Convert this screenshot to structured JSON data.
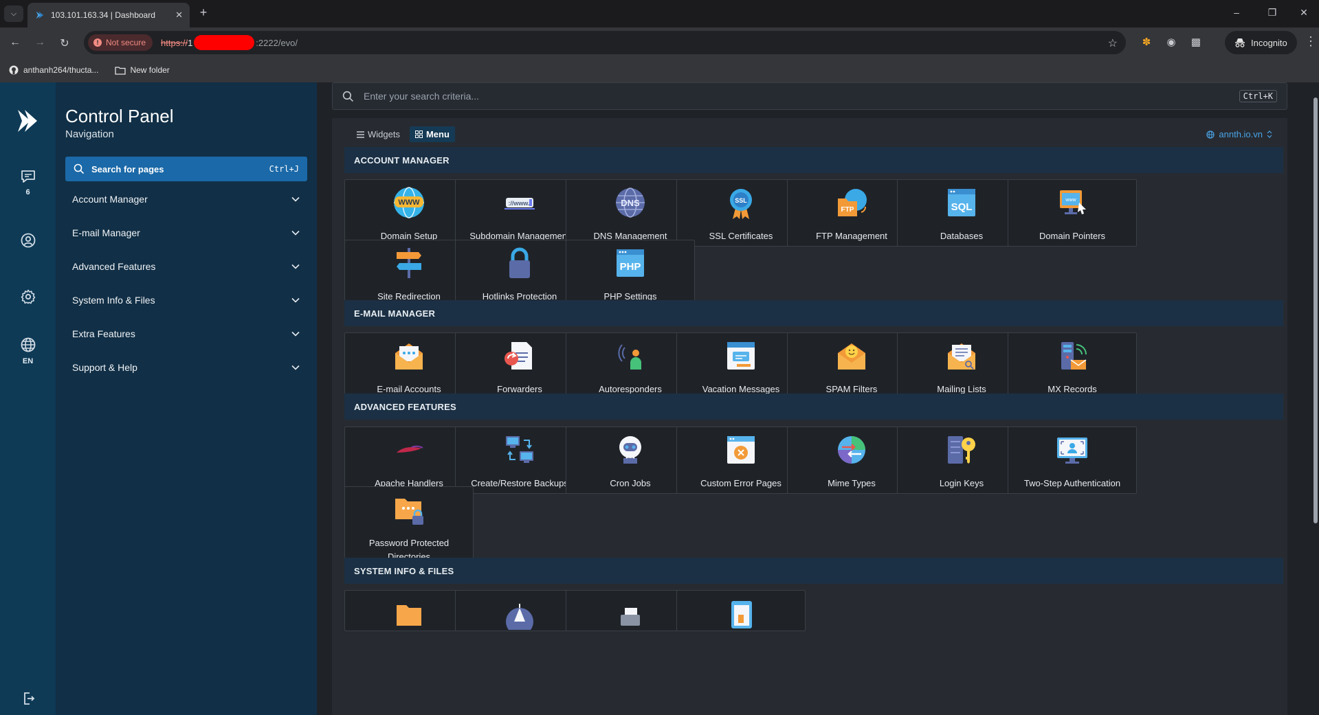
{
  "browser": {
    "tab_title": "103.101.163.34 | Dashboard",
    "not_secure": "Not secure",
    "url_proto": "https://",
    "url_host_start": "1",
    "url_rest": ":2222/evo/",
    "profile_label": "Incognito",
    "bookmarks": [
      "anthanh264/thucta...",
      "New folder"
    ]
  },
  "rail": {
    "messages_count": "6",
    "language": "EN"
  },
  "nav": {
    "title": "Control Panel",
    "subtitle": "Navigation",
    "search_label": "Search for pages",
    "search_kbd": "Ctrl+J",
    "groups": [
      "Account Manager",
      "E-mail Manager",
      "Advanced Features",
      "System Info & Files",
      "Extra Features",
      "Support & Help"
    ]
  },
  "main": {
    "search_placeholder": "Enter your search criteria...",
    "search_kbd": "Ctrl+K",
    "view_tabs": [
      "Widgets",
      "Menu"
    ],
    "domain": "annth.io.vn"
  },
  "sections": [
    {
      "title": "ACCOUNT MANAGER",
      "items": [
        {
          "label": "Domain Setup",
          "icon": "www-globe-icon"
        },
        {
          "label": "Subdomain Management",
          "icon": "subdomain-icon"
        },
        {
          "label": "DNS Management",
          "icon": "dns-globe-icon"
        },
        {
          "label": "SSL Certificates",
          "icon": "ssl-badge-icon"
        },
        {
          "label": "FTP Management",
          "icon": "ftp-folder-icon"
        },
        {
          "label": "Databases",
          "icon": "sql-database-icon"
        },
        {
          "label": "Domain Pointers",
          "icon": "domain-pointer-icon"
        },
        {
          "label": "Site Redirection",
          "icon": "signpost-icon"
        },
        {
          "label": "Hotlinks Protection",
          "icon": "padlock-icon"
        },
        {
          "label": "PHP Settings",
          "icon": "php-window-icon"
        }
      ]
    },
    {
      "title": "E-MAIL MANAGER",
      "items": [
        {
          "label": "E-mail Accounts",
          "icon": "envelope-icon"
        },
        {
          "label": "Forwarders",
          "icon": "forward-document-icon"
        },
        {
          "label": "Autoresponders",
          "icon": "autoresponder-person-icon"
        },
        {
          "label": "Vacation Messages",
          "icon": "vacation-window-icon"
        },
        {
          "label": "SPAM Filters",
          "icon": "spam-envelope-icon"
        },
        {
          "label": "Mailing Lists",
          "icon": "mailing-list-icon"
        },
        {
          "label": "MX Records",
          "icon": "mx-records-icon"
        }
      ]
    },
    {
      "title": "ADVANCED FEATURES",
      "items": [
        {
          "label": "Apache Handlers",
          "icon": "apache-feather-icon"
        },
        {
          "label": "Create/Restore Backups",
          "icon": "backup-computers-icon"
        },
        {
          "label": "Cron Jobs",
          "icon": "cron-robot-icon"
        },
        {
          "label": "Custom Error Pages",
          "icon": "error-page-icon"
        },
        {
          "label": "Mime Types",
          "icon": "mime-types-icon"
        },
        {
          "label": "Login Keys",
          "icon": "login-key-icon"
        },
        {
          "label": "Two-Step Authentication",
          "icon": "two-step-auth-icon"
        },
        {
          "label": "Password Protected Directories",
          "icon": "protected-folder-icon"
        }
      ]
    },
    {
      "title": "SYSTEM INFO & FILES",
      "items": [
        {
          "label": "",
          "icon": "folder-icon"
        },
        {
          "label": "",
          "icon": "system-info-icon"
        },
        {
          "label": "",
          "icon": "printer-icon"
        },
        {
          "label": "",
          "icon": "file-icon"
        }
      ]
    }
  ]
}
